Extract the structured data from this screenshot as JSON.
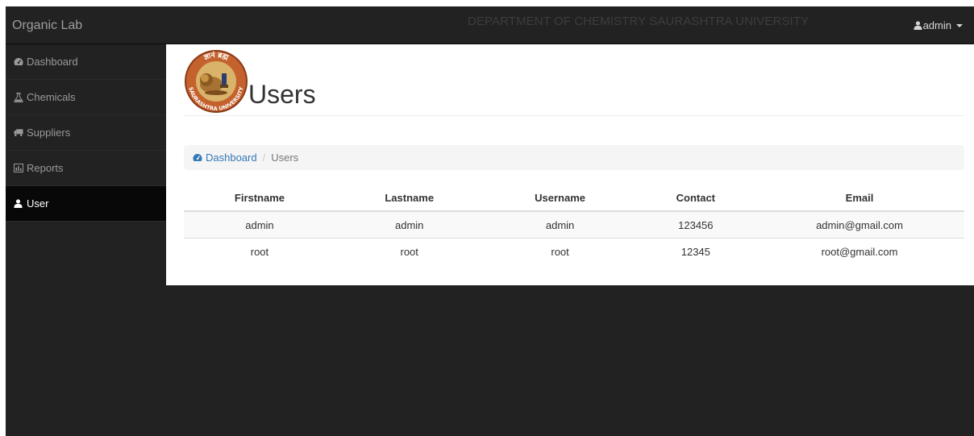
{
  "navbar": {
    "brand": "Organic Lab",
    "department": "DEPARTMENT OF CHEMISTRY SAURASHTRA UNIVERSITY",
    "user_label": "admin"
  },
  "sidebar": {
    "items": [
      {
        "label": "Dashboard",
        "icon": "tachometer-icon"
      },
      {
        "label": "Chemicals",
        "icon": "flask-icon"
      },
      {
        "label": "Suppliers",
        "icon": "truck-icon"
      },
      {
        "label": "Reports",
        "icon": "bar-chart-icon"
      },
      {
        "label": "User",
        "icon": "user-icon",
        "active": true
      }
    ]
  },
  "page": {
    "title": "Users",
    "logo": {
      "top_text": "ज्ञानं ब्रह्म",
      "bottom_text": "SAURASHTRA UNIVERSITY"
    }
  },
  "breadcrumb": {
    "link": "Dashboard",
    "current": "Users"
  },
  "table": {
    "headers": [
      "Firstname",
      "Lastname",
      "Username",
      "Contact",
      "Email"
    ],
    "rows": [
      [
        "admin",
        "admin",
        "admin",
        "123456",
        "admin@gmail.com"
      ],
      [
        "root",
        "root",
        "root",
        "12345",
        "root@gmail.com"
      ]
    ]
  },
  "colors": {
    "navbar_bg": "#222222",
    "active_item_bg": "#080808",
    "link": "#337ab7"
  }
}
